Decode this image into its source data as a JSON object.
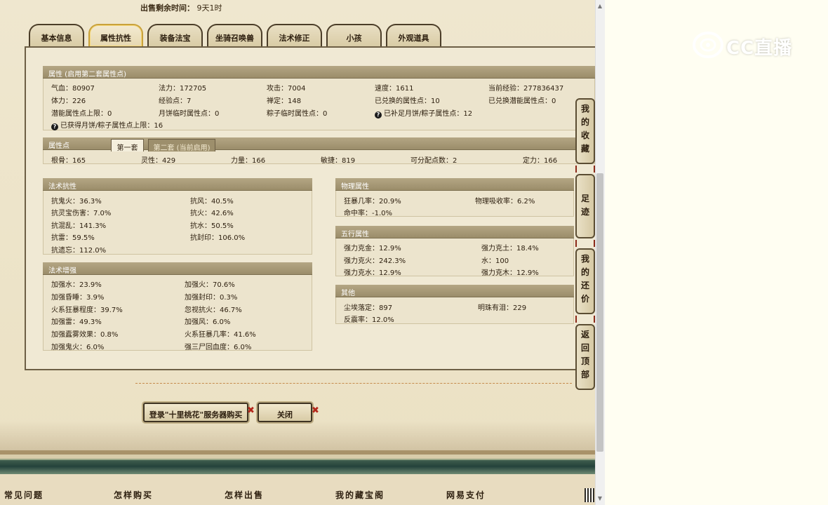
{
  "header": {
    "sale_remaining_label": "出售剩余时间：",
    "sale_remaining_value": "9天1时"
  },
  "tabs": [
    {
      "label": "基本信息"
    },
    {
      "label": "属性抗性"
    },
    {
      "label": "装备法宝"
    },
    {
      "label": "坐骑召唤兽"
    },
    {
      "label": "法术修正"
    },
    {
      "label": "小孩"
    },
    {
      "label": "外观道具"
    }
  ],
  "attributes": {
    "title": "属性 (启用第二套属性点)",
    "rows": [
      [
        "气血：80907",
        "法力：172705",
        "攻击：7004",
        "速度：1611",
        "当前经验：277836437"
      ],
      [
        "体力：226",
        "经验点：7",
        "禅定：148",
        "已兑换的属性点：10",
        "已兑换潜能属性点：0"
      ],
      [
        "潜能属性点上限：0",
        "月饼临时属性点：0",
        "粽子临时属性点：0",
        "已补足月饼/粽子属性点：12"
      ]
    ],
    "note": "已获得月饼/粽子属性点上限：16"
  },
  "attr_points": {
    "title": "属性点",
    "subtab_first": "第一套",
    "subtab_second": "第二套 (当前启用)",
    "values": [
      "根骨：165",
      "灵性：429",
      "力量：166",
      "敏捷：819",
      "可分配点数：2",
      "定力：166"
    ]
  },
  "magic_resist": {
    "title": "法术抗性",
    "items": [
      "抗鬼火：36.3%",
      "抗风：40.5%",
      "抗灵宝伤害：7.0%",
      "抗火：42.6%",
      "抗混乱：141.3%",
      "抗水：50.5%",
      "抗雷：59.5%",
      "抗封印：106.0%",
      "抗遗忘：112.0%"
    ]
  },
  "magic_boost": {
    "title": "法术增强",
    "items": [
      "加强水：23.9%",
      "加强火：70.6%",
      "加强昏睡：3.9%",
      "加强封印：0.3%",
      "火系狂暴程度：39.7%",
      "忽视抗火：46.7%",
      "加强雷：49.3%",
      "加强风：6.0%",
      "加强蠹雾效果：0.8%",
      "火系狂暴几率：41.6%",
      "加强鬼火：6.0%",
      "强三尸回血度：6.0%"
    ]
  },
  "physical": {
    "title": "物理属性",
    "items": [
      "狂暴几率：20.9%",
      "物理吸收率：6.2%",
      "命中率：-1.0%"
    ]
  },
  "five_elements": {
    "title": "五行属性",
    "items": [
      "强力克金：12.9%",
      "强力克土：18.4%",
      "强力克火：242.3%",
      "水：100",
      "强力克水：12.9%",
      "强力克木：12.9%"
    ]
  },
  "other": {
    "title": "其他",
    "items": [
      "尘埃落定：897",
      "明珠有泪：229",
      "反震率：12.0%"
    ]
  },
  "side_buttons": [
    {
      "label": "我的收藏",
      "chars": [
        "我",
        "的",
        "收",
        "藏"
      ]
    },
    {
      "label": "足迹",
      "chars": [
        "足",
        "迹"
      ]
    },
    {
      "label": "我的还价",
      "chars": [
        "我",
        "的",
        "还",
        "价"
      ]
    },
    {
      "label": "返回顶部",
      "chars": [
        "返",
        "回",
        "顶",
        "部"
      ]
    }
  ],
  "actions": {
    "login_buy": "登录\"十里桃花\"服务器购买",
    "close": "关闭",
    "x_mark": "✖"
  },
  "footer": {
    "links": [
      "常见问题",
      "怎样购买",
      "怎样出售",
      "我的藏宝阁",
      "网易支付"
    ]
  },
  "watermark": {
    "text": "CC直播"
  },
  "colors": {
    "accent_red": "#b3261a",
    "tab_active_border": "#c9a23c",
    "panel_head": "#a89a77"
  }
}
